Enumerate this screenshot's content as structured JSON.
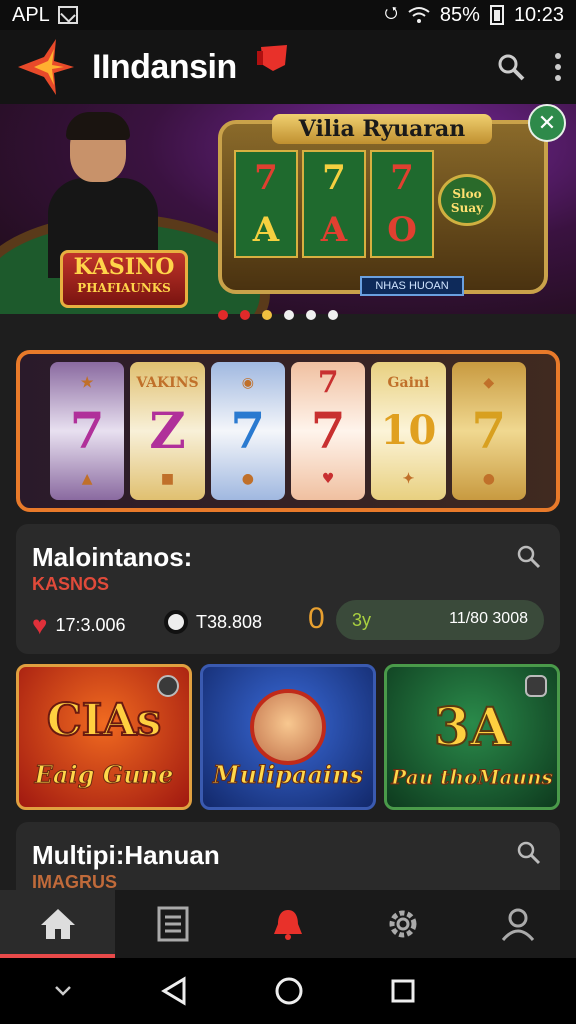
{
  "status_bar": {
    "carrier": "APL",
    "battery": "85%",
    "battery_symbol": "6",
    "time": "10:23"
  },
  "app_bar": {
    "title": "IIndansin",
    "accent": "#e8312a"
  },
  "banner": {
    "slot_title": "Vilia Ryuaran",
    "badge_line1": "KASINO",
    "badge_line2": "PHAFIAUNKS",
    "reel_symbols": [
      "7",
      "7",
      "A",
      "O"
    ],
    "slot_button": "Sloo Suay",
    "cta": "NHAS HUOAN",
    "dots": 6,
    "active_dot": 1
  },
  "reel_card": {
    "reels": [
      {
        "top": "",
        "mid": "7",
        "bot": "",
        "color": "#b0309a"
      },
      {
        "top": "VAKINS",
        "mid": "Z",
        "bot": "",
        "color": "#b0309a"
      },
      {
        "top": "",
        "mid": "7",
        "bot": "",
        "color": "#2a7ad0"
      },
      {
        "top": "7",
        "mid": "7",
        "bot": "",
        "color": "#c83030"
      },
      {
        "top": "Gaini",
        "mid": "10",
        "bot": "",
        "color": "#e0a020"
      },
      {
        "top": "",
        "mid": "7",
        "bot": "",
        "color": "#d8a020"
      }
    ]
  },
  "info_card": {
    "title": "Malointanos:",
    "subtitle": "KASNOS",
    "stat1": "17:3.006",
    "stat2": "T38.808",
    "zero": "0",
    "pill_left": "3y",
    "pill_right": "11/80 3008"
  },
  "tiles": [
    {
      "label": "Eaig Gune",
      "overlay": "CIAs"
    },
    {
      "label": "Mulipaains",
      "overlay": ""
    },
    {
      "label": "Pau thoMauns",
      "overlay": "3A"
    }
  ],
  "card2": {
    "title": "Multipi:Hanuan",
    "subtitle": "IMAGRUS"
  },
  "colors": {
    "accent_red": "#e84a4a",
    "green": "#2e8a4a",
    "card_bg": "#2a2a2a"
  }
}
